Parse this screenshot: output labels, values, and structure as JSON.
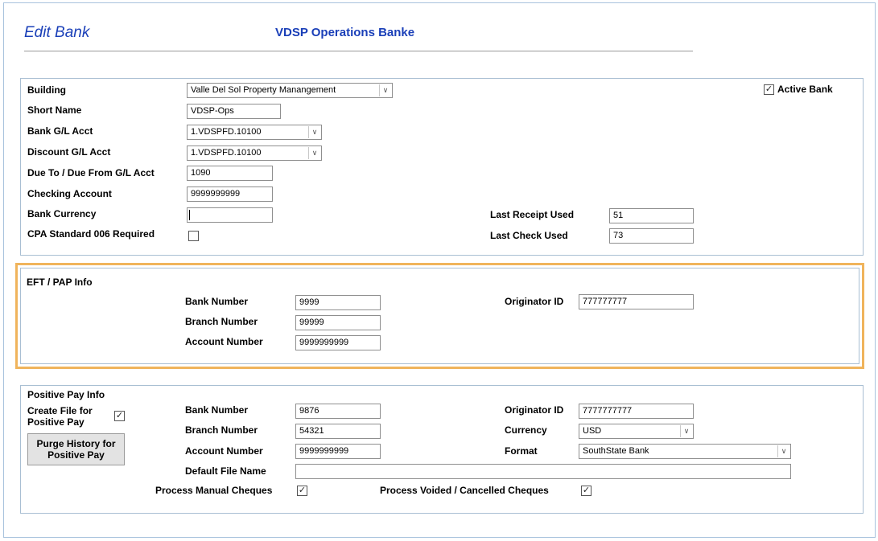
{
  "header": {
    "title": "Edit Bank",
    "bank_name": "VDSP Operations Banke"
  },
  "general": {
    "building_label": "Building",
    "building_value": "Valle Del Sol Property Manangement",
    "active_bank_label": "Active Bank",
    "active_bank_checked": true,
    "short_name_label": "Short Name",
    "short_name_value": "VDSP-Ops",
    "bank_gl_label": "Bank G/L Acct",
    "bank_gl_value": "1.VDSPFD.10100",
    "discount_gl_label": "Discount G/L Acct",
    "discount_gl_value": "1.VDSPFD.10100",
    "due_to_label": "Due To / Due From  G/L Acct",
    "due_to_value": "1090",
    "checking_label": "Checking Account",
    "checking_value": "9999999999",
    "currency_label": "Bank Currency",
    "currency_value": "",
    "cpa_label": "CPA Standard 006 Required",
    "cpa_checked": false,
    "last_receipt_label": "Last Receipt Used",
    "last_receipt_value": "51",
    "last_check_label": "Last Check Used",
    "last_check_value": "73"
  },
  "eft": {
    "section_label": "EFT / PAP  Info",
    "bank_number_label": "Bank Number",
    "bank_number_value": "9999",
    "branch_number_label": "Branch Number",
    "branch_number_value": "99999",
    "account_number_label": "Account Number",
    "account_number_value": "9999999999",
    "originator_label": "Originator ID",
    "originator_value": "777777777"
  },
  "positive_pay": {
    "section_label": "Positive Pay Info",
    "create_file_label_1": "Create File for",
    "create_file_label_2": "Positive Pay",
    "create_file_checked": true,
    "purge_label_1": "Purge History for",
    "purge_label_2": "Positive Pay",
    "bank_number_label": "Bank Number",
    "bank_number_value": "9876",
    "branch_number_label": "Branch Number",
    "branch_number_value": "54321",
    "account_number_label": "Account Number",
    "account_number_value": "9999999999",
    "default_file_label": "Default File Name",
    "default_file_value": "",
    "originator_label": "Originator ID",
    "originator_value": "7777777777",
    "currency_label": "Currency",
    "currency_value": "USD",
    "format_label": "Format",
    "format_value": "SouthState Bank",
    "manual_cheques_label": "Process Manual Cheques",
    "manual_cheques_checked": true,
    "voided_cheques_label": "Process Voided / Cancelled Cheques",
    "voided_cheques_checked": true
  },
  "icons": {
    "dropdown": "chevron-down-icon",
    "check": "checkmark-icon"
  }
}
